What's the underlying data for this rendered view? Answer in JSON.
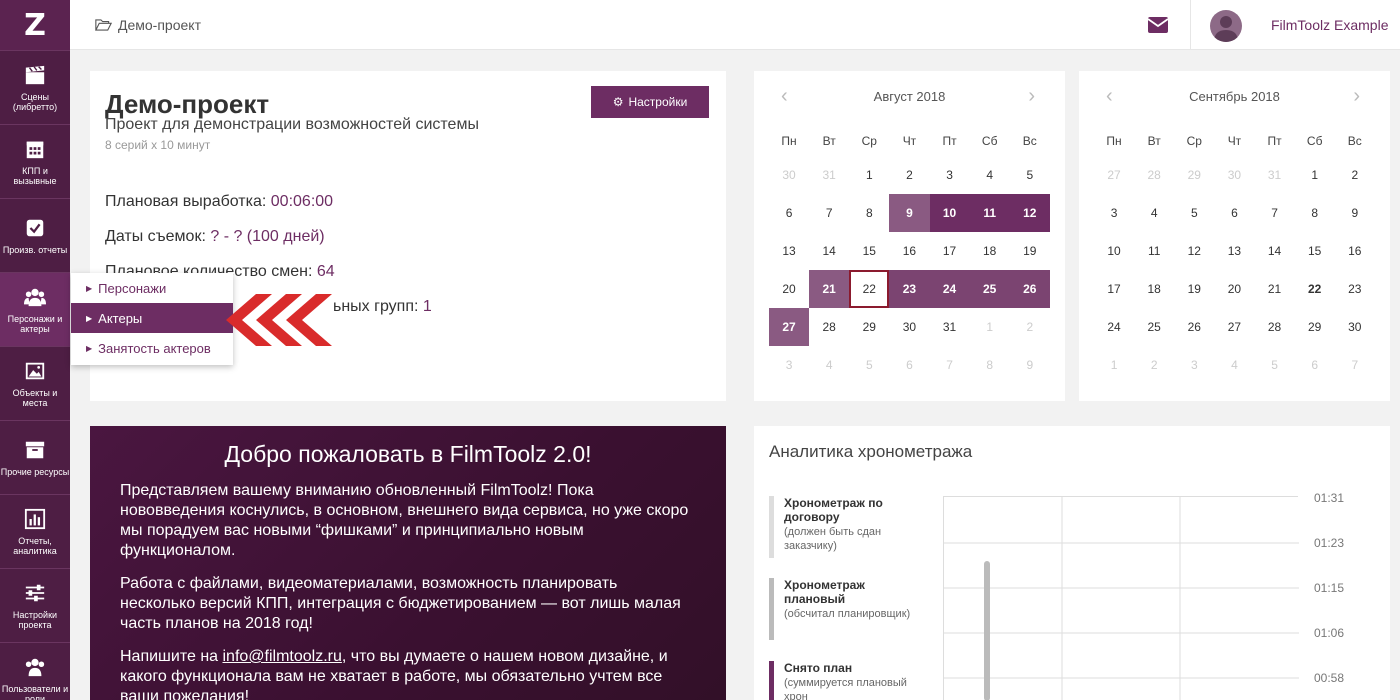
{
  "logo": "Z",
  "sidebar": [
    {
      "label": "Сцены (либретто)",
      "icon": "clapperboard-icon"
    },
    {
      "label": "КПП и вызывные",
      "icon": "calendar-icon"
    },
    {
      "label": "Произв. отчеты",
      "icon": "checkbox-icon"
    },
    {
      "label": "Персонажи и актеры",
      "icon": "people-icon"
    },
    {
      "label": "Объекты и места",
      "icon": "image-icon"
    },
    {
      "label": "Прочие ресурсы",
      "icon": "archive-icon"
    },
    {
      "label": "Отчеты, аналитика",
      "icon": "bar-chart-icon"
    },
    {
      "label": "Настройки проекта",
      "icon": "sliders-icon"
    },
    {
      "label": "Пользователи и роли",
      "icon": "users-icon"
    }
  ],
  "topbar": {
    "breadcrumb": "Демо-проект",
    "user": "FilmToolz Example"
  },
  "project": {
    "title": "Демо-проект",
    "description": "Проект для демонстрации возможностей системы",
    "sub": "8 серий х 10 минут",
    "settings": "Настройки",
    "planned_output_label": "Плановая выработка: ",
    "planned_output_value": "00:06:00",
    "dates_label": "Даты съемок: ",
    "dates_value": "? - ? (100 дней)",
    "shifts_label": "Плановое количество смен: ",
    "shifts_value": "64",
    "groups_label": "ьных групп: ",
    "groups_value": "1"
  },
  "dropdown": [
    "Персонажи",
    "Актеры",
    "Занятость актеров"
  ],
  "calendars": [
    {
      "title": "Август 2018",
      "weekdays": [
        "Пн",
        "Вт",
        "Ср",
        "Чт",
        "Пт",
        "Сб",
        "Вс"
      ],
      "weeks": [
        [
          "30",
          "31",
          "1",
          "2",
          "3",
          "4",
          "5"
        ],
        [
          "6",
          "7",
          "8",
          "9",
          "10",
          "11",
          "12"
        ],
        [
          "13",
          "14",
          "15",
          "16",
          "17",
          "18",
          "19"
        ],
        [
          "20",
          "21",
          "22",
          "23",
          "24",
          "25",
          "26"
        ],
        [
          "27",
          "28",
          "29",
          "30",
          "31",
          "1",
          "2"
        ],
        [
          "3",
          "4",
          "5",
          "6",
          "7",
          "8",
          "9"
        ]
      ]
    },
    {
      "title": "Сентябрь 2018",
      "weekdays": [
        "Пн",
        "Вт",
        "Ср",
        "Чт",
        "Пт",
        "Сб",
        "Вс"
      ],
      "weeks": [
        [
          "27",
          "28",
          "29",
          "30",
          "31",
          "1",
          "2"
        ],
        [
          "3",
          "4",
          "5",
          "6",
          "7",
          "8",
          "9"
        ],
        [
          "10",
          "11",
          "12",
          "13",
          "14",
          "15",
          "16"
        ],
        [
          "17",
          "18",
          "19",
          "20",
          "21",
          "22",
          "23"
        ],
        [
          "24",
          "25",
          "26",
          "27",
          "28",
          "29",
          "30"
        ],
        [
          "1",
          "2",
          "3",
          "4",
          "5",
          "6",
          "7"
        ]
      ]
    }
  ],
  "welcome": {
    "title": "Добро пожаловать в FilmToolz 2.0!",
    "p1": "Представляем вашему вниманию обновленный FilmToolz! Пока нововведения коснулись, в основном, внешнего вида сервиса, но уже скоро мы порадуем вас новыми “фишками” и принципиально новым функционалом.",
    "p2": "Работа с файлами, видеоматериалами, возможность планировать несколько версий КПП, интеграция с бюджетированием — вот лишь малая часть планов на 2018 год!",
    "p3_pre": "Напишите на ",
    "p3_link": "info@filmtoolz.ru",
    "p3_post": ", что вы думаете о нашем новом дизайне, и какого функционала вам не хватает в работе, мы обязательно учтем все ваши пожелания!"
  },
  "analytics": {
    "title": "Аналитика хронометража",
    "legend": [
      {
        "title": "Хронометраж по договору",
        "note": "(должен быть сдан заказчику)",
        "color": "#dddddd"
      },
      {
        "title": "Хронометраж плановый",
        "note": "(обсчитал планировщик)",
        "color": "#bbbbbb"
      },
      {
        "title": "Снято план",
        "note": "(суммируется плановый хрон",
        "color": "#6d2d63"
      }
    ],
    "y_labels": [
      "01:31",
      "01:23",
      "01:15",
      "01:06",
      "00:58"
    ]
  }
}
